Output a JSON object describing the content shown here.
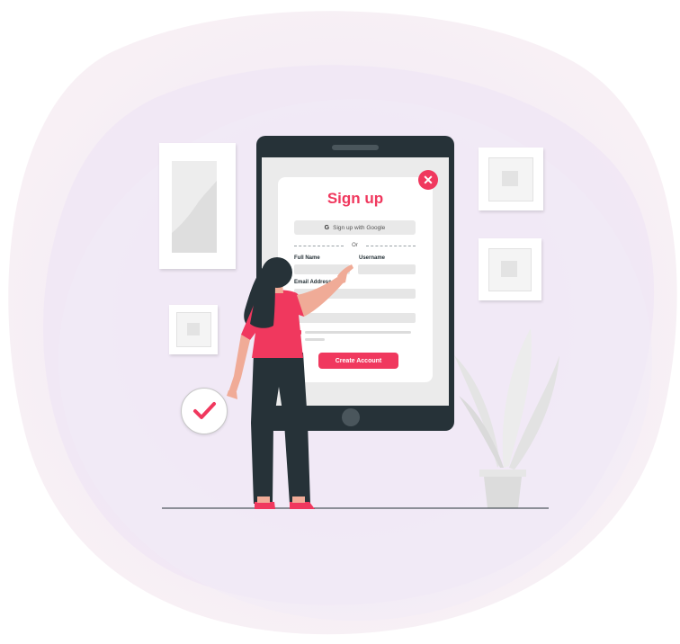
{
  "signup": {
    "title": "Sign up",
    "close_glyph": "✕",
    "google_icon": "G",
    "google_label": "Sign up with Google",
    "divider_text": "Or",
    "full_name_label": "Full Name",
    "username_label": "Username",
    "email_label": "Email Address",
    "create_label": "Create Account"
  },
  "icons": [
    "close-icon",
    "google-icon",
    "checkmark-icon",
    "plant-icon",
    "picture-frame-icon"
  ],
  "colors": {
    "accent": "#f0385e",
    "dark": "#263238",
    "background_blob": "#f1ebf7"
  }
}
